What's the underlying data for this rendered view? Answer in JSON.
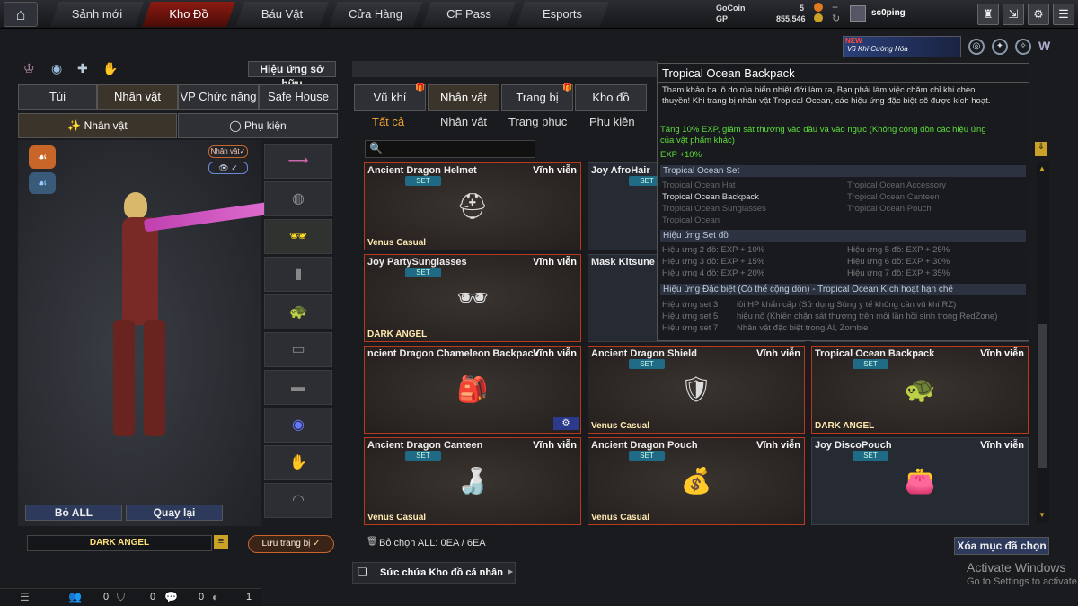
{
  "topbar": {
    "tabs": [
      "Sảnh mới",
      "Kho Đồ",
      "Báu Vật",
      "Cửa Hàng",
      "CF Pass",
      "Esports"
    ],
    "gocoin_label": "GoCoin",
    "gocoin_value": "5",
    "gp_label": "GP",
    "gp_value": "855,546",
    "player": "sc0ping"
  },
  "promo": {
    "new": "NEW",
    "text": "Vũ Khí Cường Hóa"
  },
  "left": {
    "effect_button": "Hiệu ứng sở hữu",
    "tabs": [
      "Túi",
      "Nhân vật",
      "VP Chức năng",
      "Safe House"
    ],
    "subtabs": [
      "Nhân vật",
      "Phụ kiện"
    ],
    "badge": "Nhân vật",
    "reset_button": "Bỏ ALL",
    "back_button": "Quay lại",
    "character_name": "DARK ANGEL",
    "save_button": "Lưu trang bị"
  },
  "inventory": {
    "tabs": [
      "Vũ khí",
      "Nhân vật",
      "Trang bị",
      "Kho đồ"
    ],
    "subtabs": [
      "Tất cả",
      "Nhân vật",
      "Trang phục",
      "Phụ kiện"
    ],
    "cards": [
      {
        "name": "Ancient Dragon Helmet",
        "duration": "Vĩnh viễn",
        "set": "SET",
        "class": "Venus Casual",
        "icon": "helmet-icon",
        "glyph": "⛑"
      },
      {
        "name": "Joy AfroHair",
        "duration": "",
        "set": "SET",
        "class": "",
        "icon": "hair-icon",
        "glyph": ""
      },
      {
        "name": "",
        "duration": "",
        "set": "",
        "class": "",
        "icon": "",
        "glyph": ""
      },
      {
        "name": "Joy PartySunglasses",
        "duration": "Vĩnh viễn",
        "set": "SET",
        "class": "DARK ANGEL",
        "icon": "sunglasses-icon",
        "glyph": "🕶"
      },
      {
        "name": "Mask Kitsune",
        "duration": "",
        "set": "",
        "class": "",
        "icon": "mask-icon",
        "glyph": ""
      },
      {
        "name": "",
        "duration": "",
        "set": "",
        "class": "",
        "icon": "",
        "glyph": ""
      },
      {
        "name": "ncient Dragon Chameleon Backpack",
        "duration": "Vĩnh viễn",
        "set": "",
        "class": "",
        "icon": "backpack-icon",
        "glyph": "🎒"
      },
      {
        "name": "Ancient Dragon Shield",
        "duration": "Vĩnh viễn",
        "set": "SET",
        "class": "Venus Casual",
        "icon": "shield-icon",
        "glyph": "🛡"
      },
      {
        "name": "Tropical Ocean Backpack",
        "duration": "Vĩnh viễn",
        "set": "SET",
        "class": "DARK ANGEL",
        "icon": "backpack-icon",
        "glyph": "🐢"
      },
      {
        "name": "Ancient Dragon Canteen",
        "duration": "Vĩnh viễn",
        "set": "SET",
        "class": "Venus Casual",
        "icon": "canteen-icon",
        "glyph": "🍶"
      },
      {
        "name": "Ancient Dragon Pouch",
        "duration": "Vĩnh viễn",
        "set": "SET",
        "class": "Venus Casual",
        "icon": "pouch-icon",
        "glyph": "💰"
      },
      {
        "name": "Joy DiscoPouch",
        "duration": "Vĩnh viễn",
        "set": "SET",
        "class": "",
        "icon": "pouch-icon",
        "glyph": "👛"
      }
    ],
    "selection": "Bỏ chọn ALL: 0EA / 6EA",
    "clear_button": "Xóa mục đã chọn",
    "capacity": "Sức chứa Kho đồ cá nhân"
  },
  "tooltip": {
    "title": "Tropical Ocean Backpack",
    "desc1": "Tham khảo ba lô do rùa biển nhiệt đới làm ra, Bạn phải làm việc chăm chỉ khi chèo",
    "desc2": "thuyền! Khi trang bị nhân vật Tropical Ocean, các hiệu ứng đặc biệt sẽ được kích hoạt.",
    "effect1": "Tăng 10% EXP, giảm sát thương vào đầu và vào ngực (Không cộng dồn các hiệu ứng",
    "effect2": "của vật phẩm khác)",
    "effect3": "EXP +10%",
    "set_head": "Tropical Ocean Set",
    "set_items": [
      "Tropical Ocean Hat",
      "Tropical Ocean Accessory",
      "Tropical Ocean Backpack",
      "Tropical Ocean Canteen",
      "Tropical Ocean Sunglasses",
      "Tropical Ocean Pouch",
      "Tropical Ocean"
    ],
    "bonus_head": "Hiệu ứng Set đồ",
    "bonuses": [
      "Hiệu ứng 2 đồ: EXP + 10%",
      "Hiệu ứng 5 đồ: EXP + 25%",
      "Hiệu ứng 3 đồ: EXP + 15%",
      "Hiệu ứng 6 đồ: EXP + 30%",
      "Hiệu ứng 4 đồ: EXP + 20%",
      "Hiệu ứng 7 đồ: EXP + 35%"
    ],
    "special_head": "Hiệu ứng Đặc biệt (Có thể cộng dồn) - Tropical Ocean Kích hoạt hạn chế",
    "special": [
      {
        "k": "Hiệu ứng set 3",
        "v": "lồi HP khẩn cấp (Sử dụng Súng y tế không cần vũ khí RZ)"
      },
      {
        "k": "Hiệu ứng set 5",
        "v": "hiệu nổ (Khiên chặn sát thương trên mỗi lần hồi sinh trong RedZone)"
      },
      {
        "k": "Hiệu ứng set 7",
        "v": "Nhân vật đặc biệt trong AI, Zombie"
      }
    ]
  },
  "bottombar": {
    "c1": "0",
    "c2": "0",
    "c3": "0",
    "c4": "1"
  },
  "watermark": {
    "line1": "Activate Windows",
    "line2": "Go to Settings to activate Windows."
  },
  "colors": {
    "accent": "#b93a1f",
    "active_tab": "#8b1a12",
    "set_badge": "#1f6a84"
  }
}
